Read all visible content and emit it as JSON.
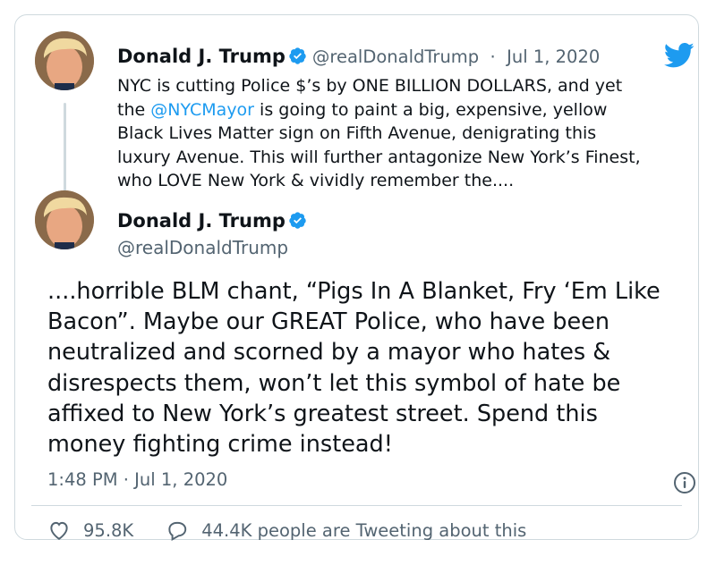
{
  "tweet1": {
    "name": "Donald J. Trump",
    "handle": "@realDonaldTrump",
    "separator": "·",
    "date": "Jul 1, 2020",
    "text_before_mention": "NYC is cutting Police $’s by ONE BILLION DOLLARS, and yet\nthe ",
    "mention": "@NYCMayor",
    "text_after_mention": " is going to paint a big, expensive, yellow\nBlack Lives Matter sign on Fifth Avenue, denigrating this\nluxury Avenue. This will further antagonize New York’s Finest,\nwho LOVE New York & vividly remember the...."
  },
  "tweet2": {
    "name": "Donald J. Trump",
    "handle": "@realDonaldTrump",
    "text": "....horrible BLM chant, “Pigs In A Blanket, Fry ‘Em Like\nBacon”. Maybe our GREAT Police, who have been\nneutralized and scorned by a mayor who hates &\ndisrespects them, won’t let this symbol of hate be\naffixed to New York’s greatest street. Spend this\nmoney fighting crime instead!",
    "timestamp": "1:48 PM · Jul 1, 2020"
  },
  "stats": {
    "likes": "95.8K",
    "replies": "44.4K people are Tweeting about this"
  },
  "icons": {
    "verified": "verified-badge-icon",
    "twitter": "twitter-bird-icon",
    "info": "info-icon",
    "like": "heart-icon",
    "reply": "reply-bubble-icon"
  },
  "colors": {
    "accent": "#1d9bf0",
    "text": "#0f1419",
    "muted": "#536471",
    "border": "#cfd9de"
  }
}
